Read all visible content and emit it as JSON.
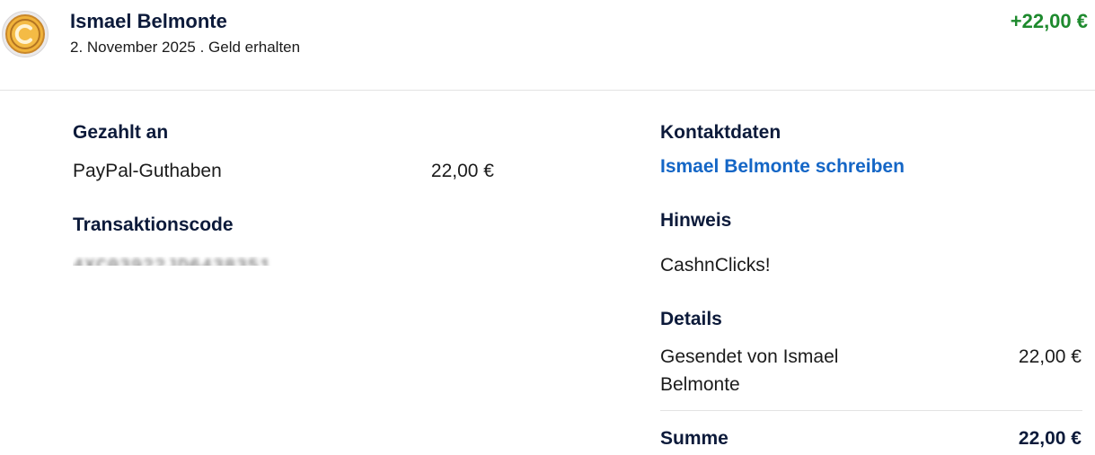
{
  "transaction": {
    "name": "Ismael Belmonte",
    "date_status": "2. November 2025 . Geld erhalten",
    "amount": "+22,00 €",
    "avatar_icon": "coin-icon",
    "amount_color": "#1e8a2e"
  },
  "paid_to": {
    "heading": "Gezahlt an",
    "method": "PayPal-Guthaben",
    "amount": "22,00 €"
  },
  "transaction_code": {
    "heading": "Transaktionscode",
    "value": "4XC03922JD6438351"
  },
  "contact": {
    "heading": "Kontaktdaten",
    "link_label": "Ismael Belmonte schreiben",
    "link_color": "#1466c6"
  },
  "note": {
    "heading": "Hinweis",
    "text": "CashnClicks!"
  },
  "details": {
    "heading": "Details",
    "line_label_1": "Gesendet von Ismael",
    "line_label_2": "Belmonte",
    "line_amount": "22,00 €",
    "total_label": "Summe",
    "total_amount": "22,00 €"
  }
}
